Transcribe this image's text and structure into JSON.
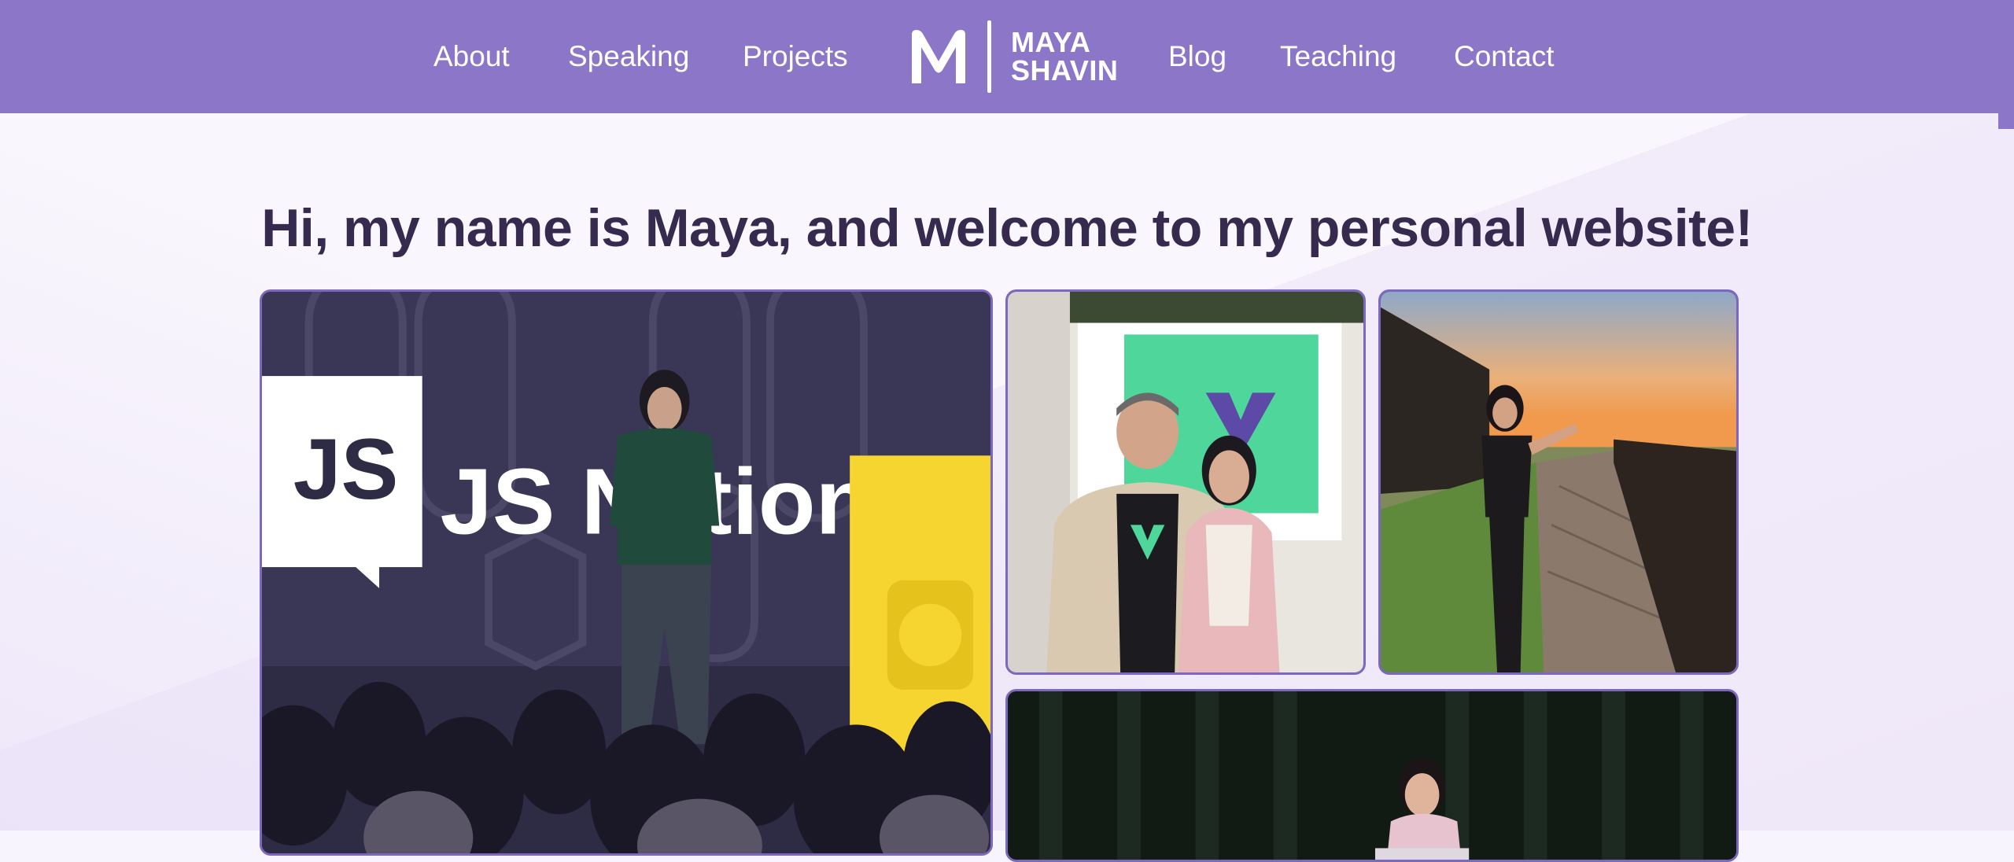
{
  "nav": {
    "left": [
      "About",
      "Speaking",
      "Projects"
    ],
    "right": [
      "Blog",
      "Teaching",
      "Contact"
    ],
    "logo": {
      "line1": "MAYA",
      "line2": "SHAVIN"
    }
  },
  "hero": {
    "title": "Hi, my name is Maya, and welcome to my personal website!"
  },
  "photos": {
    "stage_sign": "JS Nation",
    "colors": {
      "brand": "#8b76c8",
      "border": "#7d68c0",
      "heading": "#362b4e"
    }
  }
}
